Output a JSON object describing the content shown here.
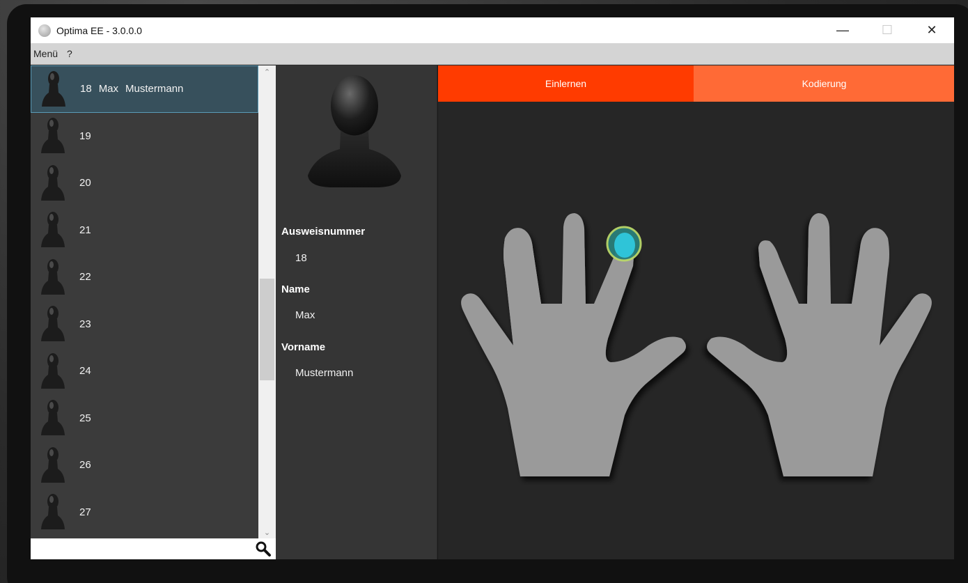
{
  "window": {
    "title": "Optima EE - 3.0.0.0",
    "controls": {
      "minimize": "—",
      "maximize": "☐",
      "close": "✕"
    }
  },
  "menu": {
    "items": [
      "Menü",
      "?"
    ]
  },
  "user_list": {
    "selected": {
      "id": "18",
      "first": "Max",
      "last": "Mustermann"
    },
    "others": [
      "19",
      "20",
      "21",
      "22",
      "23",
      "24",
      "25",
      "26",
      "27"
    ]
  },
  "search": {
    "value": "",
    "placeholder": ""
  },
  "details": {
    "ausweis_label": "Ausweisnummer",
    "ausweis_value": "18",
    "name_label": "Name",
    "name_value": "Max",
    "vorname_label": "Vorname",
    "vorname_value": "Mustermann"
  },
  "tabs": {
    "einlernen": "Einlernen",
    "kodierung": "Kodierung"
  },
  "colors": {
    "tab_active": "#ff3b00",
    "tab_inactive": "#ff6a36",
    "hand_fill": "#9a9a9a",
    "finger_marker": "#2fc4d8",
    "finger_marker_ring": "#b9d86a"
  },
  "selected_finger": "left-index-finger"
}
